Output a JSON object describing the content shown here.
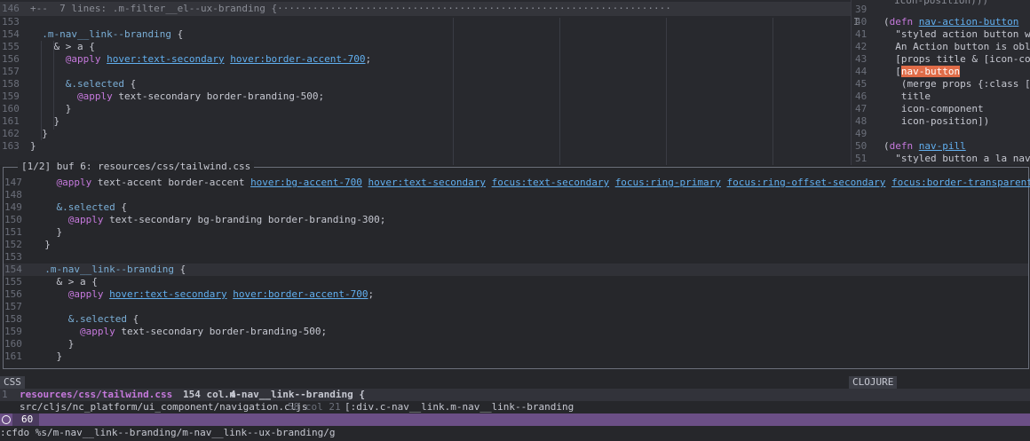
{
  "top_left": {
    "fold_text": "+--  7 lines: .m-filter__el--ux-branding {···································································",
    "fold_num": "146",
    "lines": [
      {
        "num": "153",
        "text": ""
      },
      {
        "num": "154",
        "text": "  .m-nav__link--branding {"
      },
      {
        "num": "155",
        "text": "    & > a {"
      },
      {
        "num": "156",
        "text": "      @apply hover:text-secondary hover:border-accent-700;"
      },
      {
        "num": "157",
        "text": ""
      },
      {
        "num": "158",
        "text": "      &.selected {"
      },
      {
        "num": "159",
        "text": "        @apply text-secondary border-branding-500;"
      },
      {
        "num": "160",
        "text": "      }"
      },
      {
        "num": "161",
        "text": "    }"
      },
      {
        "num": "162",
        "text": "  }"
      },
      {
        "num": "163",
        "text": "}"
      }
    ]
  },
  "top_right": {
    "lines": [
      {
        "num": "39",
        "text": ""
      },
      {
        "num": "40",
        "text": "(defn nav-action-button"
      },
      {
        "num": "41",
        "text": "  \"styled action button with"
      },
      {
        "num": "42",
        "text": "  An Action button is oblivi"
      },
      {
        "num": "43",
        "text": "  [props title & [icon-compo"
      },
      {
        "num": "44",
        "text": "  [nav-button"
      },
      {
        "num": "45",
        "text": "   (merge props {:class [\"c-"
      },
      {
        "num": "46",
        "text": "   title"
      },
      {
        "num": "47",
        "text": "   icon-component"
      },
      {
        "num": "48",
        "text": "   icon-position])"
      },
      {
        "num": "49",
        "text": ""
      },
      {
        "num": "50",
        "text": "(defn nav-pill"
      },
      {
        "num": "51",
        "text": "  \"styled button a la nav-pi"
      }
    ],
    "top_text": "icon-position)))",
    "cursor_marker": "I"
  },
  "popup": {
    "title": "[1/2] buf 6: resources/css/tailwind.css",
    "lines": [
      {
        "num": "147",
        "text": "    @apply text-accent border-accent hover:bg-accent-700 hover:text-secondary focus:text-secondary focus:ring-primary focus:ring-offset-secondary focus:border-transparent;"
      },
      {
        "num": "148",
        "text": ""
      },
      {
        "num": "149",
        "text": "    &.selected {"
      },
      {
        "num": "150",
        "text": "      @apply text-secondary bg-branding border-branding-300;"
      },
      {
        "num": "151",
        "text": "    }"
      },
      {
        "num": "152",
        "text": "  }"
      },
      {
        "num": "153",
        "text": ""
      },
      {
        "num": "154",
        "text": "  .m-nav__link--branding {"
      },
      {
        "num": "155",
        "text": "    & > a {"
      },
      {
        "num": "156",
        "text": "      @apply hover:text-secondary hover:border-accent-700;"
      },
      {
        "num": "157",
        "text": ""
      },
      {
        "num": "158",
        "text": "      &.selected {"
      },
      {
        "num": "159",
        "text": "        @apply text-secondary border-branding-500;"
      },
      {
        "num": "160",
        "text": "      }"
      },
      {
        "num": "161",
        "text": "    }"
      }
    ]
  },
  "bottom": {
    "tab_left": "CSS",
    "tab_right": "CLOJURE",
    "row1_num": "1",
    "row1_file": "resources/css/tailwind.css",
    "row1_pos": "154 col 4",
    "row1_code": ".m-nav__link--branding {",
    "row2_file": "src/cljs/nc_platform/ui_component/navigation.cljs",
    "row2_pos": "58 col 21",
    "row2_code": "[:div.c-nav__link.m-nav__link--branding",
    "status_count": "60",
    "command": ":cfdo %s/m-nav__link--branding/m-nav__link--ux-branding/g"
  },
  "colors": {
    "accent_purple": "#6b4f86",
    "highlight_orange": "#e06c48",
    "keyword": "#c679dd",
    "selector": "#7aaed6"
  }
}
